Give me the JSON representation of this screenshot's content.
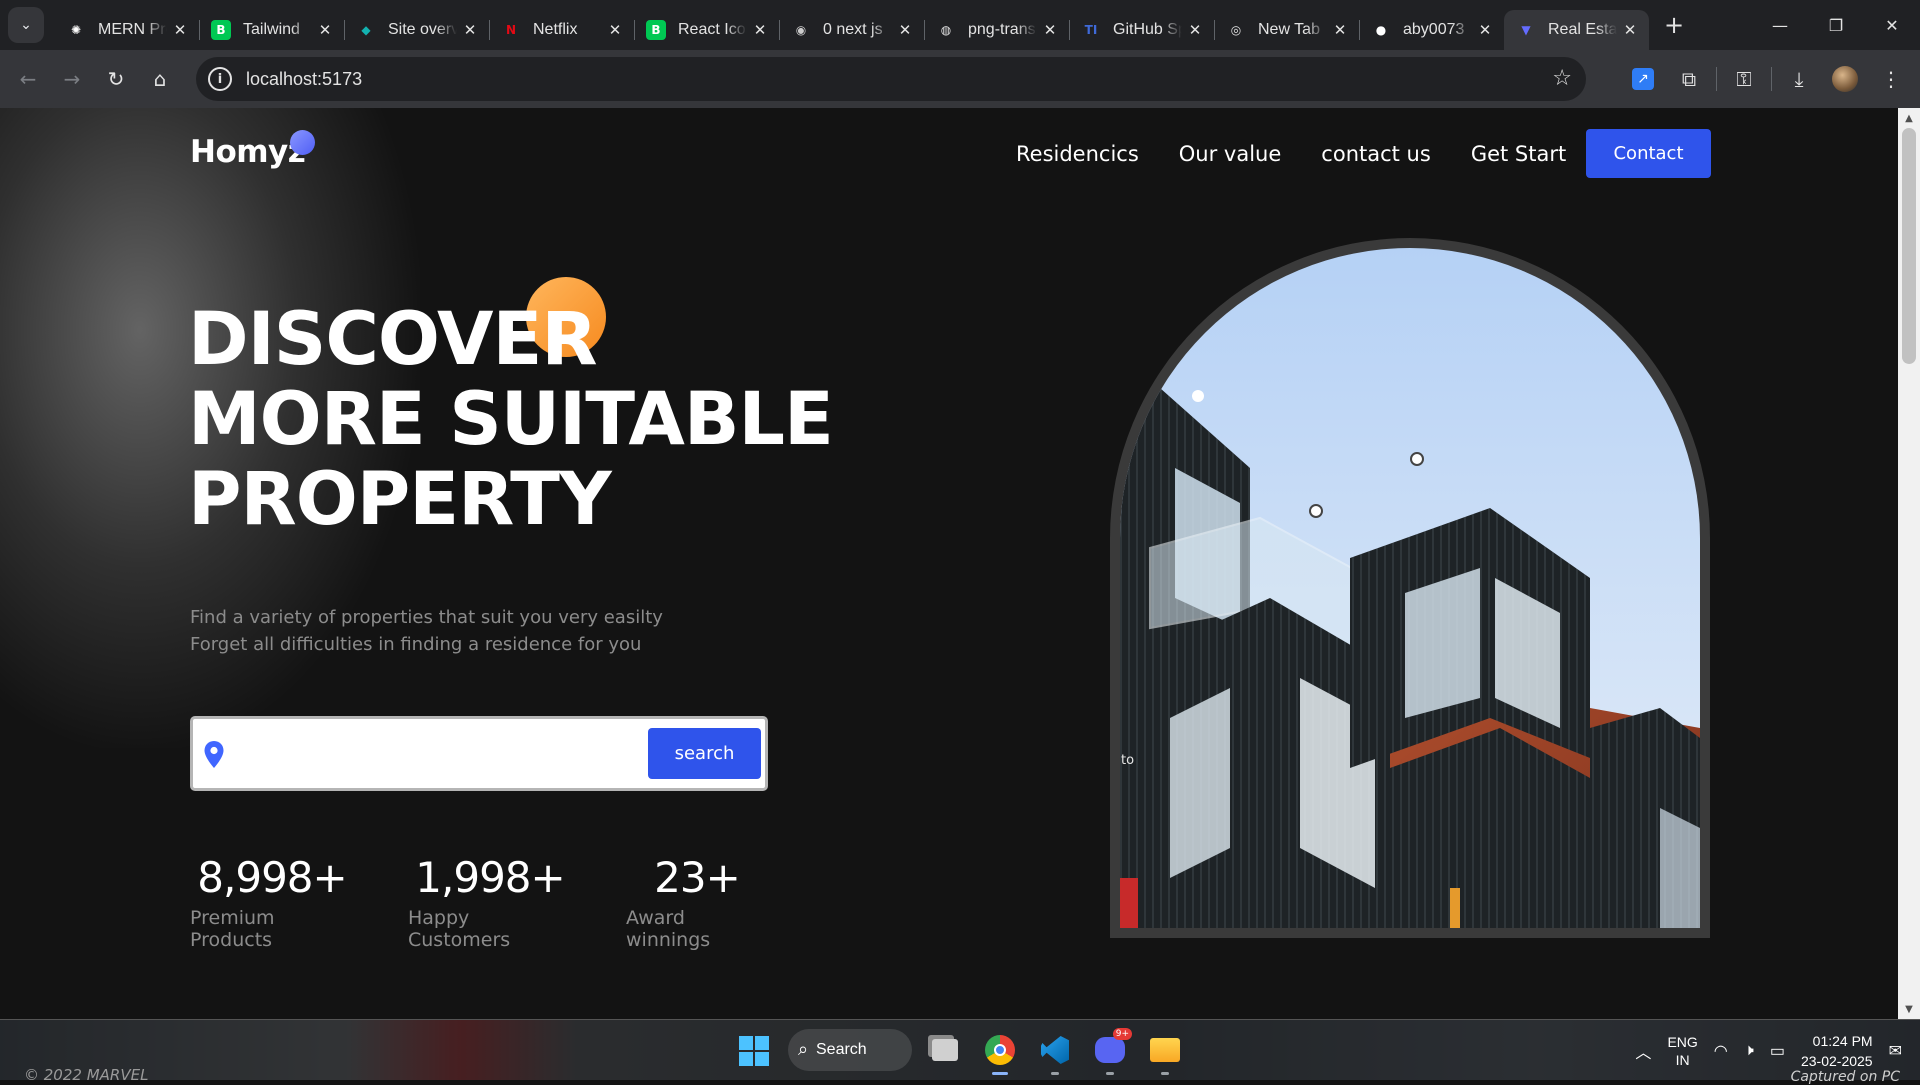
{
  "browser": {
    "tabs": [
      {
        "title": "MERN Project",
        "favicon": "openai-icon",
        "color": "#ffffff"
      },
      {
        "title": "Tailwind",
        "favicon": "green-b-icon",
        "color": "#00c853"
      },
      {
        "title": "Site overview",
        "favicon": "netlify-icon",
        "color": "#13b2b0"
      },
      {
        "title": "Netflix",
        "favicon": "netflix-icon",
        "color": "#e50914"
      },
      {
        "title": "React Icons",
        "favicon": "green-b-icon",
        "color": "#00c853"
      },
      {
        "title": "0 next js",
        "favicon": "github-copilot-icon",
        "color": "#cccccc"
      },
      {
        "title": "png-transparent",
        "favicon": "globe-icon",
        "color": "#e3e3e3"
      },
      {
        "title": "GitHub Sponsors",
        "favicon": "tech-icons-icon",
        "color": "#3f6ad8"
      },
      {
        "title": "New Tab",
        "favicon": "chrome-icon",
        "color": "#e3e3e3"
      },
      {
        "title": "aby0073",
        "favicon": "github-icon",
        "color": "#ffffff"
      },
      {
        "title": "Real Estate",
        "favicon": "vite-icon",
        "color": "#646cff",
        "active": true
      }
    ],
    "url": "localhost:5173"
  },
  "site": {
    "logo": "Homyz",
    "nav": [
      "Residencics",
      "Our value",
      "contact us",
      "Get Start"
    ],
    "contact_label": "Contact",
    "headline": [
      "DISCOVER",
      "MORE SUITABLE",
      "PROPERTY"
    ],
    "subtitle": [
      "Find a variety of properties that suit you very easilty",
      "Forget all difficulties in finding a residence for you"
    ],
    "search": {
      "placeholder": "",
      "button": "search"
    },
    "stats": [
      {
        "value": "8,998+",
        "label": "Premium Products"
      },
      {
        "value": "1,998+",
        "label": "Happy Customers"
      },
      {
        "value": "23+",
        "label": "Award winnings"
      }
    ],
    "hero_image_label": "to",
    "colors": {
      "accent": "#2f54eb",
      "orange": "#f68a1f",
      "logo_dot": "#6b78ff"
    }
  },
  "taskbar": {
    "watermark": "© 2022 MARVEL",
    "search_label": "Search",
    "discord_badge": "9+",
    "language": [
      "ENG",
      "IN"
    ],
    "time": "01:24 PM",
    "date": "23-02-2025",
    "footer_text": "Captured on PC"
  }
}
